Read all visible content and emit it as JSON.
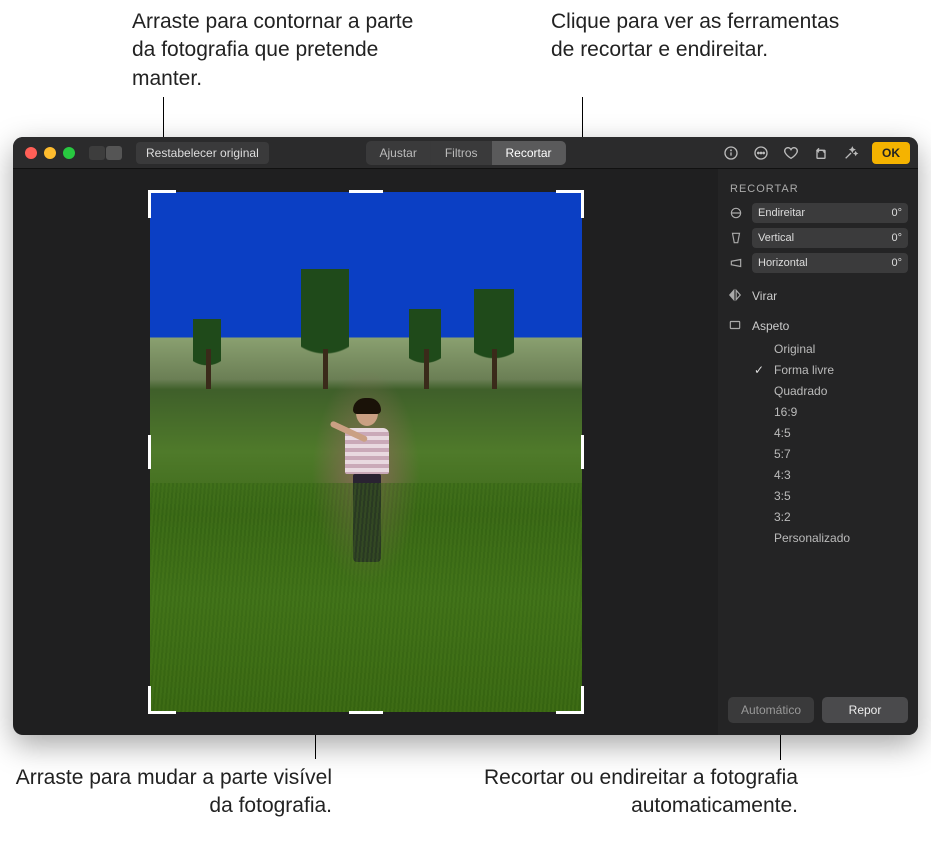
{
  "callouts": {
    "top_left": "Arraste para contornar a parte da fotografia que pretende manter.",
    "top_right": "Clique para ver as ferramentas de recortar e endireitar.",
    "bottom_left": "Arraste para mudar a parte visível da fotografia.",
    "bottom_right": "Recortar ou endireitar a fotografia automaticamente."
  },
  "toolbar": {
    "revert": "Restabelecer original",
    "tabs": {
      "adjust": "Ajustar",
      "filters": "Filtros",
      "crop": "Recortar"
    },
    "ok": "OK"
  },
  "panel": {
    "title": "RECORTAR",
    "sliders": {
      "straighten": {
        "label": "Endireitar",
        "value": "0°"
      },
      "vertical": {
        "label": "Vertical",
        "value": "0°"
      },
      "horizontal": {
        "label": "Horizontal",
        "value": "0°"
      }
    },
    "flip": "Virar",
    "aspect_label": "Aspeto",
    "aspects": {
      "original": "Original",
      "freeform": "Forma livre",
      "square": "Quadrado",
      "r16_9": "16:9",
      "r4_5": "4:5",
      "r5_7": "5:7",
      "r4_3": "4:3",
      "r3_5": "3:5",
      "r3_2": "3:2",
      "custom": "Personalizado"
    },
    "footer": {
      "auto": "Automático",
      "reset": "Repor"
    }
  }
}
